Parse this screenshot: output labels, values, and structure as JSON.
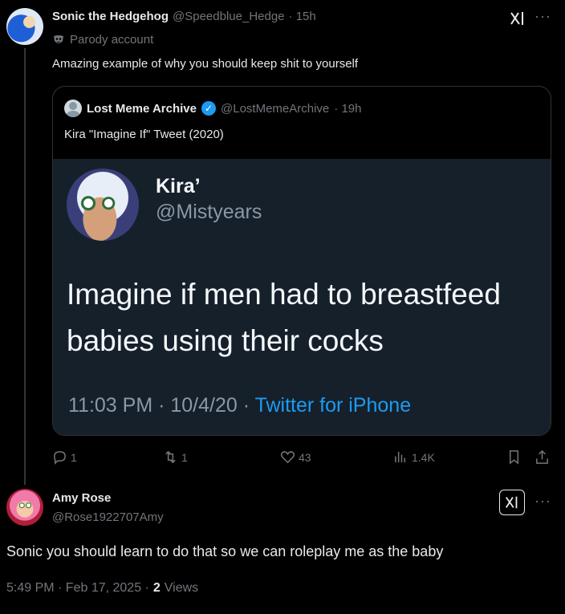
{
  "original_post": {
    "author_name": "Sonic the Hedgehog",
    "author_handle": "@Speedblue_Hedge",
    "time": "· 15h",
    "label": "Parody account",
    "text": "Amazing example of why you should keep shit to yourself",
    "quote": {
      "author_name": "Lost Meme Archive",
      "author_handle": "@LostMemeArchive",
      "time": "· 19h",
      "text": "Kira \"Imagine If\" Tweet (2020)",
      "media": {
        "name": "Kira’",
        "handle": "@Mistyears",
        "text": "Imagine if men had to breastfeed babies using their cocks",
        "timestamp": "11:03 PM · 10/4/20 ·",
        "client": "Twitter for iPhone"
      }
    },
    "stats": {
      "replies": "1",
      "reposts": "1",
      "likes": "43",
      "views": "1.4K"
    }
  },
  "reply": {
    "author_name": "Amy Rose",
    "author_handle": "@Rose1922707Amy",
    "text": "Sonic you should learn to do that so we can roleplay me as the baby",
    "time": "5:49 PM · Feb 17, 2025 ·",
    "views_count": "2",
    "views_label": "Views"
  },
  "icons": {
    "grok": "grok-icon",
    "more": "more-icon",
    "reply": "reply-icon",
    "repost": "repost-icon",
    "like": "heart-icon",
    "views": "views-icon",
    "bookmark": "bookmark-icon",
    "share": "share-icon",
    "parody": "mask-icon"
  },
  "colors": {
    "accent": "#1d9bf0",
    "muted": "#71767b",
    "background": "#000000"
  }
}
